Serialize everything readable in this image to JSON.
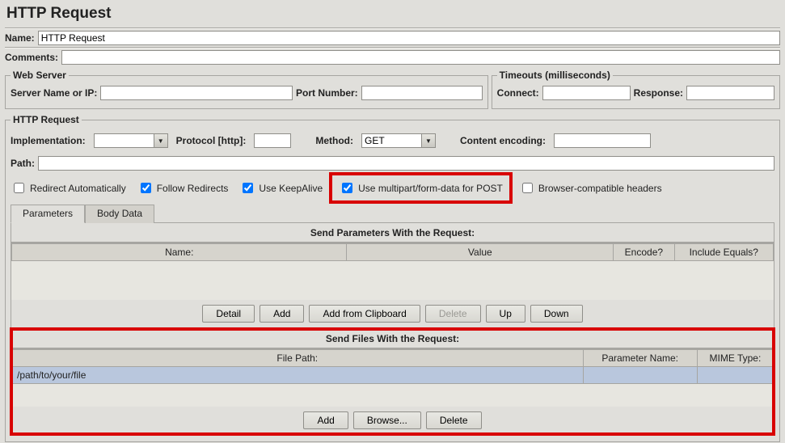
{
  "title": "HTTP Request",
  "name": {
    "label": "Name:",
    "value": "HTTP Request"
  },
  "comments": {
    "label": "Comments:",
    "value": ""
  },
  "web_server": {
    "legend": "Web Server",
    "server_label": "Server Name or IP:",
    "server_value": "",
    "port_label": "Port Number:",
    "port_value": ""
  },
  "timeouts": {
    "legend": "Timeouts (milliseconds)",
    "connect_label": "Connect:",
    "connect_value": "",
    "response_label": "Response:",
    "response_value": ""
  },
  "http_request": {
    "legend": "HTTP Request",
    "implementation_label": "Implementation:",
    "implementation_value": "",
    "protocol_label": "Protocol [http]:",
    "protocol_value": "",
    "method_label": "Method:",
    "method_value": "GET",
    "encoding_label": "Content encoding:",
    "encoding_value": "",
    "path_label": "Path:",
    "path_value": "",
    "redirect_auto": "Redirect Automatically",
    "follow_redirects": "Follow Redirects",
    "keepalive": "Use KeepAlive",
    "multipart": "Use multipart/form-data for POST",
    "browser_compat": "Browser-compatible headers",
    "redirect_auto_checked": false,
    "follow_redirects_checked": true,
    "keepalive_checked": true,
    "multipart_checked": true,
    "browser_compat_checked": false
  },
  "tabs": {
    "parameters": "Parameters",
    "body_data": "Body Data",
    "selected": "parameters"
  },
  "params_section": {
    "header": "Send Parameters With the Request:",
    "cols": {
      "name": "Name:",
      "value": "Value",
      "encode": "Encode?",
      "include_equals": "Include Equals?"
    },
    "rows": [],
    "buttons": {
      "detail": "Detail",
      "add": "Add",
      "add_clip": "Add from Clipboard",
      "delete": "Delete",
      "up": "Up",
      "down": "Down"
    }
  },
  "files_section": {
    "header": "Send Files With the Request:",
    "cols": {
      "file_path": "File Path:",
      "param_name": "Parameter Name:",
      "mime": "MIME Type:"
    },
    "rows": [
      {
        "file_path": "/path/to/your/file",
        "param_name": "",
        "mime": ""
      }
    ],
    "buttons": {
      "add": "Add",
      "browse": "Browse...",
      "delete": "Delete"
    }
  }
}
